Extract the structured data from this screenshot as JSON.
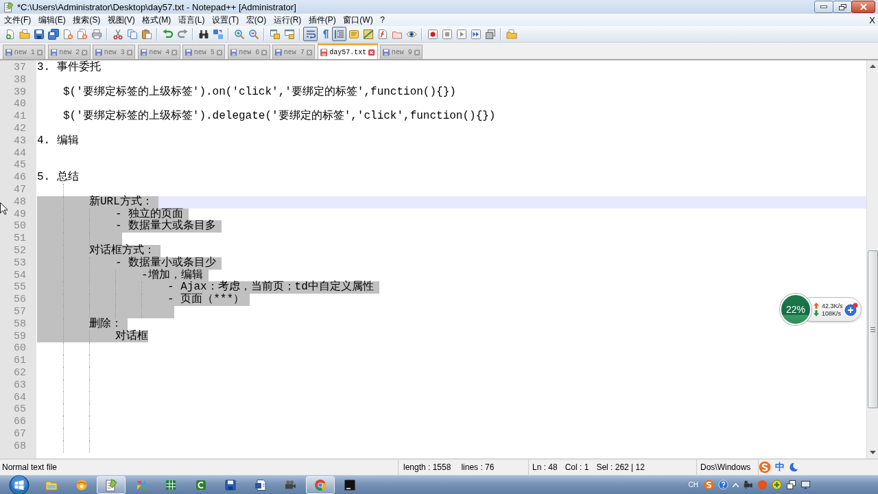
{
  "window": {
    "title": "*C:\\Users\\Administrator\\Desktop\\day57.txt - Notepad++ [Administrator]"
  },
  "menu": {
    "items": [
      "文件(F)",
      "编辑(E)",
      "搜索(S)",
      "视图(V)",
      "格式(M)",
      "语言(L)",
      "设置(T)",
      "宏(O)",
      "运行(R)",
      "插件(P)",
      "窗口(W)",
      "?"
    ],
    "close_document": "X"
  },
  "toolbar": {
    "groups": [
      [
        {
          "kind": "new",
          "pressed": false
        },
        {
          "kind": "open",
          "pressed": false
        },
        {
          "kind": "save",
          "pressed": false
        },
        {
          "kind": "saveall",
          "pressed": false
        },
        {
          "kind": "close",
          "pressed": false
        },
        {
          "kind": "closeall",
          "pressed": false
        },
        {
          "kind": "print",
          "pressed": false
        }
      ],
      [
        {
          "kind": "cut",
          "pressed": false
        },
        {
          "kind": "copy",
          "pressed": false
        },
        {
          "kind": "paste",
          "pressed": false
        }
      ],
      [
        {
          "kind": "undo",
          "pressed": false
        },
        {
          "kind": "redo",
          "pressed": false
        }
      ],
      [
        {
          "kind": "find",
          "pressed": false
        },
        {
          "kind": "replace",
          "pressed": false
        }
      ],
      [
        {
          "kind": "zoomin",
          "pressed": false
        },
        {
          "kind": "zoomout",
          "pressed": false
        }
      ],
      [
        {
          "kind": "syncv",
          "pressed": false
        },
        {
          "kind": "synch",
          "pressed": false
        }
      ],
      [
        {
          "kind": "wrap",
          "pressed": true
        },
        {
          "kind": "allchars",
          "pressed": false
        },
        {
          "kind": "guides",
          "pressed": true
        },
        {
          "kind": "udl",
          "pressed": false
        },
        {
          "kind": "docmap",
          "pressed": false
        },
        {
          "kind": "funclist",
          "pressed": false
        },
        {
          "kind": "folderws",
          "pressed": false
        },
        {
          "kind": "monitor",
          "pressed": false
        }
      ],
      [
        {
          "kind": "record",
          "pressed": false
        },
        {
          "kind": "stop",
          "pressed": false
        },
        {
          "kind": "play",
          "pressed": false
        },
        {
          "kind": "playmulti",
          "pressed": false
        },
        {
          "kind": "savemacro",
          "pressed": false
        }
      ],
      [
        {
          "kind": "workspace",
          "pressed": false
        }
      ]
    ]
  },
  "tabs": [
    {
      "label": "new 1",
      "selected": false,
      "modified": false
    },
    {
      "label": "new 2",
      "selected": false,
      "modified": false
    },
    {
      "label": "new 3",
      "selected": false,
      "modified": false
    },
    {
      "label": "new 4",
      "selected": false,
      "modified": false
    },
    {
      "label": "new 5",
      "selected": false,
      "modified": false
    },
    {
      "label": "new 6",
      "selected": false,
      "modified": false
    },
    {
      "label": "new 7",
      "selected": false,
      "modified": false
    },
    {
      "label": "day57.txt",
      "selected": true,
      "modified": true
    },
    {
      "label": "new 9",
      "selected": false,
      "modified": false
    }
  ],
  "editor": {
    "lines": [
      {
        "number": "37",
        "text": "3. 事件委托",
        "selected": false,
        "current": false
      },
      {
        "number": "38",
        "selected": false,
        "current": false
      },
      {
        "number": "39",
        "text": "\t$('要绑定标签的上级标签').on('click','要绑定的标签',function(){})",
        "selected": false,
        "current": false
      },
      {
        "number": "40",
        "selected": false,
        "current": false
      },
      {
        "number": "41",
        "text": "\t$('要绑定标签的上级标签').delegate('要绑定的标签','click',function(){})",
        "selected": false,
        "current": false
      },
      {
        "number": "42",
        "selected": false,
        "current": false
      },
      {
        "number": "43",
        "text": "4. 编辑",
        "selected": false,
        "current": false
      },
      {
        "number": "44",
        "selected": false,
        "current": false
      },
      {
        "number": "45",
        "selected": false,
        "current": false
      },
      {
        "number": "46",
        "text": "5. 总结",
        "selected": false,
        "current": false
      },
      {
        "number": "47",
        "selected": false,
        "current": false
      },
      {
        "number": "48",
        "text": "\t\t新URL方式：",
        "selected": true,
        "current": true
      },
      {
        "number": "49",
        "text": "\t\t\t- 独立的页面",
        "selected": true,
        "current": false
      },
      {
        "number": "50",
        "text": "\t\t\t- 数据量大或条目多",
        "selected": true,
        "current": false
      },
      {
        "number": "51",
        "selected": true,
        "current": false
      },
      {
        "number": "52",
        "text": "\t\t对话框方式：",
        "selected": true,
        "current": false
      },
      {
        "number": "53",
        "text": "\t\t\t- 数据量小或条目少",
        "selected": true,
        "current": false
      },
      {
        "number": "54",
        "text": "\t\t\t\t-增加，编辑",
        "selected": true,
        "current": false
      },
      {
        "number": "55",
        "text": "\t\t\t\t\t- Ajax：考虑，当前页；td中自定义属性",
        "selected": true,
        "current": false
      },
      {
        "number": "56",
        "text": "\t\t\t\t\t- 页面（***）",
        "selected": true,
        "current": false
      },
      {
        "number": "57",
        "selected": true,
        "current": false
      },
      {
        "number": "58",
        "text": "\t\t删除：",
        "selected": true,
        "current": false
      },
      {
        "number": "59",
        "text": "\t\t\t对话框",
        "selected": true,
        "current": false
      },
      {
        "number": "60",
        "selected": false,
        "current": false
      },
      {
        "number": "61",
        "selected": false,
        "current": false
      },
      {
        "number": "62",
        "selected": false,
        "current": false
      },
      {
        "number": "63",
        "selected": false,
        "current": false
      },
      {
        "number": "64",
        "selected": false,
        "current": false
      },
      {
        "number": "65",
        "selected": false,
        "current": false
      },
      {
        "number": "66",
        "selected": false,
        "current": false
      },
      {
        "number": "67",
        "selected": false,
        "current": false
      },
      {
        "number": "68",
        "selected": false,
        "current": false
      }
    ]
  },
  "status_bar": {
    "file_type": "Normal text file",
    "length": "length : 1558",
    "lines": "lines : 76",
    "line": "Ln : 48",
    "column": "Col : 1",
    "selection": "Sel : 262 | 12",
    "line_endings": "Dos\\Windows"
  },
  "ime_bar": {
    "mode": "中"
  },
  "monitor_widget": {
    "percent": "22%",
    "upload": "42.3K/s",
    "download": "108K/s"
  },
  "taskbar": {
    "apps": [
      {
        "kind": "explorer",
        "active": false
      },
      {
        "kind": "ball",
        "active": false
      },
      {
        "kind": "notepad",
        "active": true
      },
      {
        "kind": "pinwheel",
        "active": false
      },
      {
        "kind": "spreadsheet",
        "active": false
      },
      {
        "kind": "arctile",
        "active": false
      },
      {
        "kind": "floppy",
        "active": false
      },
      {
        "kind": "document",
        "active": false
      },
      {
        "kind": "camera",
        "active": false
      },
      {
        "kind": "browser",
        "active": true
      },
      {
        "kind": "tile",
        "active": false
      }
    ],
    "tray": {
      "language": "CH"
    }
  }
}
